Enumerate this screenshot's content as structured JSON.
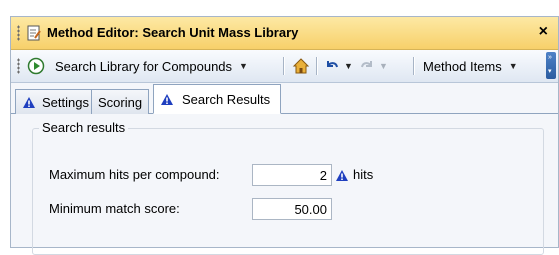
{
  "window": {
    "title": "Method Editor: Search Unit Mass Library",
    "close_symbol": "×"
  },
  "toolbar": {
    "search_button_label": "Search Library for Compounds",
    "method_items_label": "Method Items",
    "icons": [
      "play-circle-icon",
      "home-icon",
      "undo-icon",
      "redo-icon"
    ]
  },
  "tabs": [
    {
      "label": "Settings",
      "icon": "warning-triangle-icon",
      "active": false
    },
    {
      "label": "Scoring",
      "icon": null,
      "active": false
    },
    {
      "label": "Search Results",
      "icon": "warning-triangle-icon",
      "active": true
    }
  ],
  "search_results": {
    "group_title": "Search results",
    "max_hits_label": "Maximum hits per compound:",
    "max_hits_value": "2",
    "max_hits_units": "hits",
    "min_score_label": "Minimum match score:",
    "min_score_value": "50.00"
  },
  "colors": {
    "title_bar": "#f7d06a",
    "toolbar": "#dfe7f2",
    "warning_icon": "#1f3fbf"
  }
}
